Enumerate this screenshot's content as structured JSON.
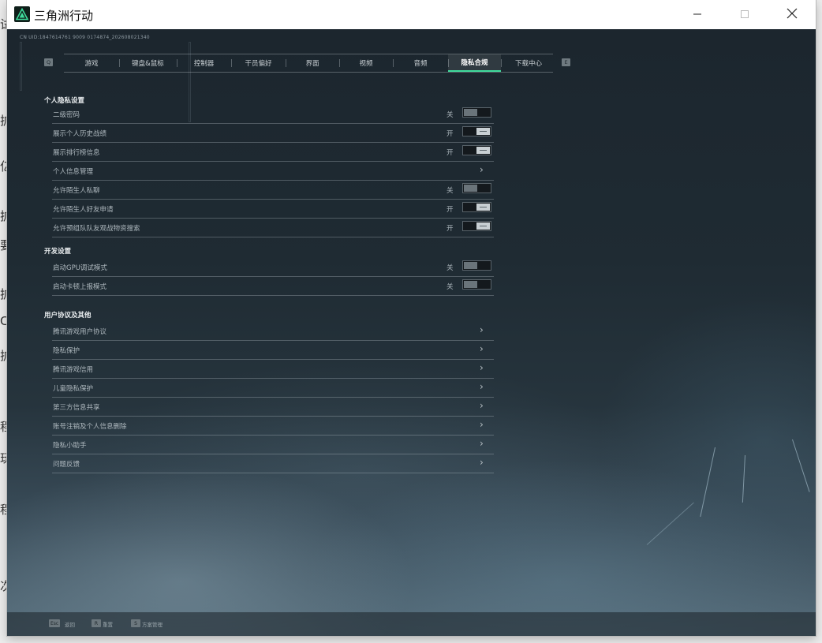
{
  "desktop": {
    "side_chars": [
      "试",
      "扩",
      "亿",
      "扩",
      "要",
      "扩",
      "C",
      "扩",
      "程",
      "玩",
      "程",
      "次"
    ]
  },
  "window": {
    "title": "三角洲行动",
    "icons": {
      "logo": "delta-logo-icon",
      "minimize": "minimize-icon",
      "maximize": "maximize-icon",
      "close": "close-icon"
    }
  },
  "game": {
    "uid_text": "CN UID:1847614761 9009 0174874_202608021340",
    "nav": {
      "prev_key": "Q",
      "next_key": "E",
      "tabs": [
        "游戏",
        "键盘&鼠标",
        "控制器",
        "干员偏好",
        "界面",
        "视频",
        "音频",
        "隐私合规",
        "下载中心"
      ],
      "active_index": 7
    },
    "sections": [
      {
        "title": "个人隐私设置",
        "rows": [
          {
            "label": "二级密码",
            "state": "关",
            "control": "toggle",
            "on": false
          },
          {
            "label": "展示个人历史战绩",
            "state": "开",
            "control": "toggle",
            "on": true
          },
          {
            "label": "展示排行榜信息",
            "state": "开",
            "control": "toggle",
            "on": true
          },
          {
            "label": "个人信息管理",
            "state": "",
            "control": "link"
          },
          {
            "label": "允许陌生人私聊",
            "state": "关",
            "control": "toggle",
            "on": false
          },
          {
            "label": "允许陌生人好友申请",
            "state": "开",
            "control": "toggle",
            "on": true
          },
          {
            "label": "允许预组队队友观战物资搜索",
            "state": "开",
            "control": "toggle",
            "on": true
          }
        ]
      },
      {
        "title": "开发设置",
        "rows": [
          {
            "label": "启动GPU调试模式",
            "state": "关",
            "control": "toggle",
            "on": false
          },
          {
            "label": "启动卡顿上报模式",
            "state": "关",
            "control": "toggle",
            "on": false
          }
        ]
      },
      {
        "title": "用户协议及其他",
        "rows": [
          {
            "label": "腾讯游戏用户协议",
            "state": "",
            "control": "link"
          },
          {
            "label": "隐私保护",
            "state": "",
            "control": "link"
          },
          {
            "label": "腾讯游戏信用",
            "state": "",
            "control": "link"
          },
          {
            "label": "儿童隐私保护",
            "state": "",
            "control": "link"
          },
          {
            "label": "第三方信息共享",
            "state": "",
            "control": "link"
          },
          {
            "label": "账号注销及个人信息删除",
            "state": "",
            "control": "link"
          },
          {
            "label": "隐私小助手",
            "state": "",
            "control": "link"
          },
          {
            "label": "问题反馈",
            "state": "",
            "control": "link"
          }
        ]
      }
    ],
    "bottom_bar": [
      {
        "key": "Esc",
        "label": "返回"
      },
      {
        "key": "R",
        "label": "重置"
      },
      {
        "key": "S",
        "label": "方案管理"
      }
    ],
    "colors": {
      "accent": "#3fdc9c",
      "panel_bg": "#1f2b33"
    }
  }
}
